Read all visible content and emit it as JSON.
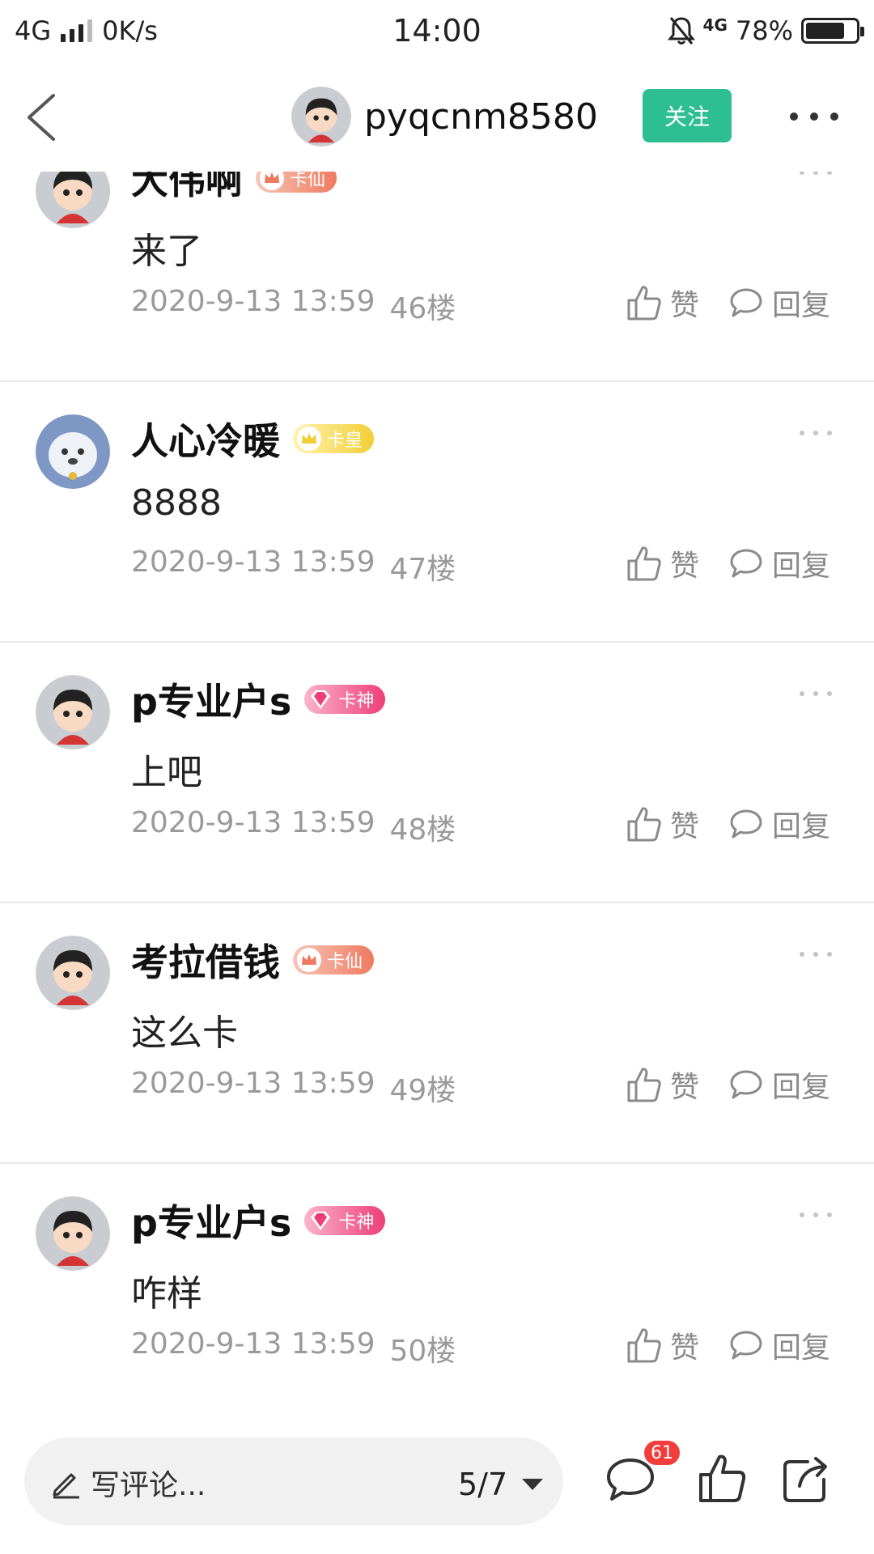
{
  "status_bar": {
    "network": "4G",
    "speed": "0K/s",
    "time": "14:00",
    "net_right": "4G",
    "battery": "78%",
    "battery_level": 0.78
  },
  "header": {
    "username": "pyqcnm8580",
    "follow_label": "关注"
  },
  "comments": [
    {
      "name": "大伟啊",
      "badge": "卡仙",
      "text": "来了",
      "time": "2020-9-13 13:59",
      "floor": "46楼",
      "like": "赞",
      "reply": "回复"
    },
    {
      "name": "人心冷暖",
      "badge": "卡皇",
      "text": "8888",
      "time": "2020-9-13 13:59",
      "floor": "47楼",
      "like": "赞",
      "reply": "回复"
    },
    {
      "name": "p专业户s",
      "badge": "卡神",
      "text": "上吧",
      "time": "2020-9-13 13:59",
      "floor": "48楼",
      "like": "赞",
      "reply": "回复"
    },
    {
      "name": "考拉借钱",
      "badge": "卡仙",
      "text": "这么卡",
      "time": "2020-9-13 13:59",
      "floor": "49楼",
      "like": "赞",
      "reply": "回复"
    },
    {
      "name": "p专业户s",
      "badge": "卡神",
      "text": "咋样",
      "time": "2020-9-13 13:59",
      "floor": "50楼",
      "like": "赞",
      "reply": "回复"
    }
  ],
  "bottom_bar": {
    "placeholder": "写评论...",
    "page": "5/7",
    "comment_count": "61"
  },
  "colors": {
    "follow": "#2dbf92",
    "badge_count": "#f23d3d"
  }
}
